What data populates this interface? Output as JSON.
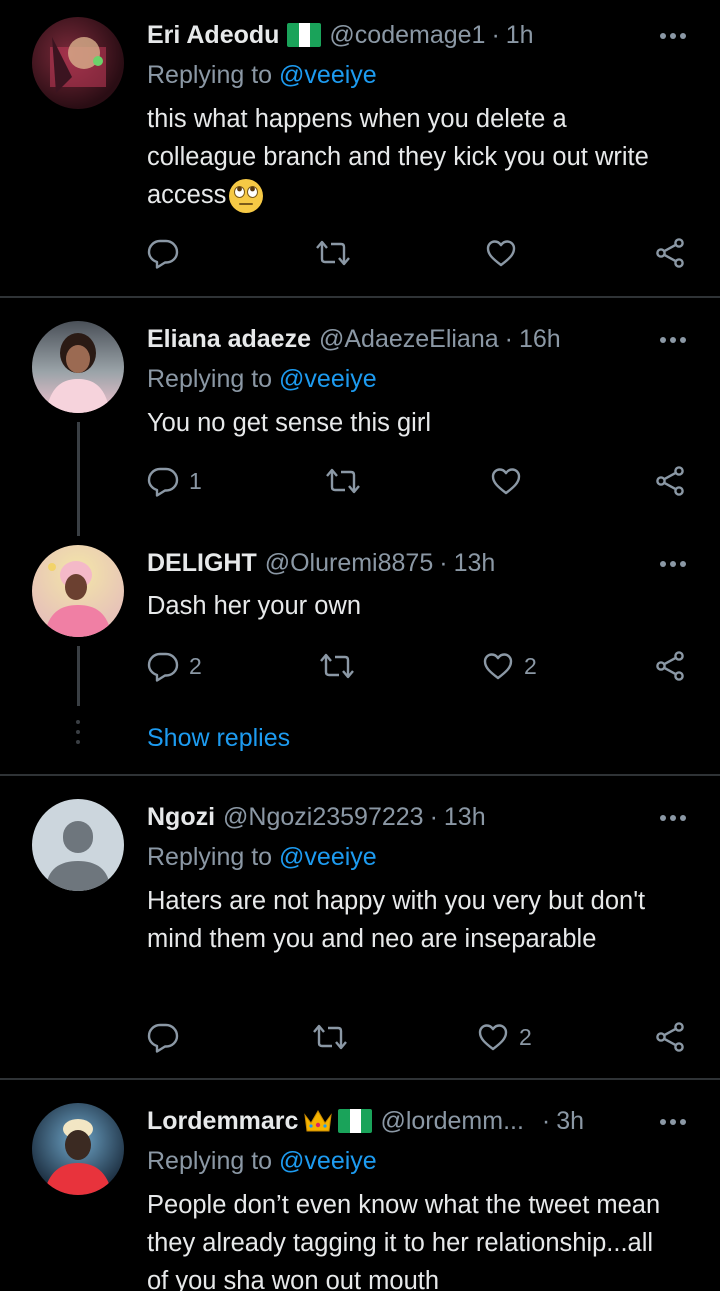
{
  "tweets": [
    {
      "name": "Eri Adeodu",
      "handle": "@codemage1",
      "sep": "·",
      "time": "1h",
      "replying_prefix": "Replying to",
      "replying_to": "@veeiye",
      "text": "this what happens when you delete a colleague branch and they kick you out write access",
      "flag": "nigeria-flag",
      "emoji": "face-with-rolling-eyes"
    },
    {
      "name": "Eliana adaeze",
      "handle": "@AdaezeEliana",
      "sep": "·",
      "time": "16h",
      "replying_prefix": "Replying to",
      "replying_to": "@veeiye",
      "text": "You no get sense this girl",
      "reply_count": "1"
    },
    {
      "name": "DELIGHT",
      "handle": "@Oluremi8875",
      "sep": "·",
      "time": "13h",
      "text": "Dash her your own",
      "reply_count": "2",
      "like_count": "2",
      "show_replies": "Show replies"
    },
    {
      "name": "Ngozi",
      "handle": "@Ngozi23597223",
      "sep": "·",
      "time": "13h",
      "replying_prefix": "Replying to",
      "replying_to": "@veeiye",
      "text": "Haters are not happy with you very but don't mind them you and neo are inseparable",
      "like_count": "2"
    },
    {
      "name": "Lordemmarc",
      "handle": "@lordemm...",
      "sep": "·",
      "time": "3h",
      "replying_prefix": "Replying to",
      "replying_to": "@veeiye",
      "text": "People don’t even know what the tweet mean they already tagging it to her relationship...all of you sha won out mouth",
      "flag": "nigeria-flag",
      "emoji": "crown"
    }
  ],
  "colors": {
    "background": "#000000",
    "text": "#e7e9ea",
    "muted": "#8b98a5",
    "accent": "#1d9bf0",
    "divider": "#2f3336"
  },
  "icons": [
    "reply-icon",
    "retweet-icon",
    "like-icon",
    "share-icon",
    "more-icon"
  ]
}
